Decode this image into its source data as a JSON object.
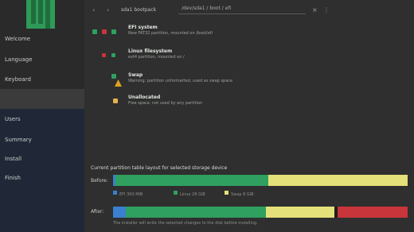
{
  "sidebar": {
    "items": [
      {
        "label": "Welcome"
      },
      {
        "label": "Language"
      },
      {
        "label": "Keyboard"
      },
      {
        "label": "Users"
      },
      {
        "label": "Summary"
      },
      {
        "label": "Install"
      },
      {
        "label": "Finish"
      }
    ]
  },
  "toolbar": {
    "breadcrumb": "sda1 bootpack",
    "path_value": "/dev/sda1 / boot / efi"
  },
  "partitions": [
    {
      "name": "EFI system",
      "desc": "New FAT32 partition, mounted on /boot/efi"
    },
    {
      "name": "Linux filesystem",
      "desc": "ext4 partition, mounted on /"
    },
    {
      "name": "Swap",
      "desc": "Warning: partition unformatted, used as swap space"
    },
    {
      "name": "Unallocated",
      "desc": "Free space, not used by any partition"
    }
  ],
  "usage": {
    "title": "Current partition table layout for selected storage device",
    "before_label": "Before:",
    "after_label": "After:",
    "legend": [
      "EFI 300 MiB",
      "Linux 28 GiB",
      "Swap 8 GiB"
    ],
    "footnote": "The installer will write the selected changes to the disk before installing."
  },
  "colors": {
    "green": "#2fa05f",
    "yellow": "#e5e17a",
    "blue": "#3a7fd0",
    "red": "#c8353a"
  }
}
